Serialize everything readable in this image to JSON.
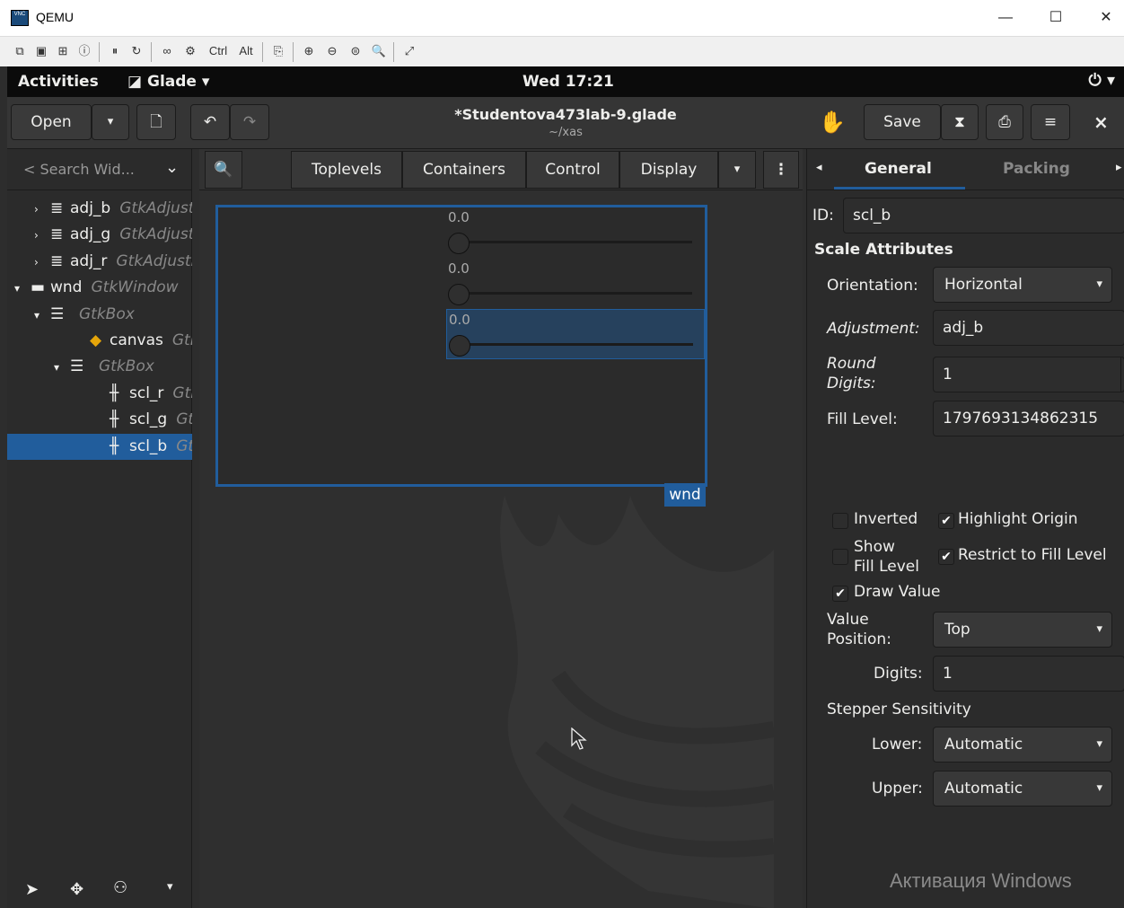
{
  "qemu": {
    "title": "QEMU",
    "logo_text": "VNC",
    "minimize": "—",
    "maximize": "☐",
    "close": "✕",
    "toolbar": [
      "⧉",
      "▣",
      "⊞",
      "ⓘ",
      "⏸",
      "↻",
      "∞",
      "⚙",
      "Ctrl",
      "Alt",
      "⎘",
      "⊕",
      "⊖",
      "⊜",
      "🔍",
      "⤢"
    ]
  },
  "topbar": {
    "activities": "Activities",
    "app_menu": "Glade ▾",
    "app_icon": "glade-icon",
    "clock": "Wed 17:21",
    "power": "⏻ ▾"
  },
  "header": {
    "open_label": "Open",
    "open_arrow": "▾",
    "new_icon": "🗋",
    "undo": "↶",
    "redo": "↷",
    "title": "*Studentova473lab-9.glade",
    "subtitle": "~/xas",
    "save_label": "Save",
    "close": "×"
  },
  "tree": {
    "search_placeholder": "< Search Wid...",
    "search_arrow": "⌄",
    "rows": [
      {
        "expander": "›",
        "icon": "≣",
        "name": "adj_b",
        "type": "GtkAdjustment",
        "indent": 1
      },
      {
        "expander": "›",
        "icon": "≣",
        "name": "adj_g",
        "type": "GtkAdjustment",
        "indent": 1
      },
      {
        "expander": "›",
        "icon": "≣",
        "name": "adj_r",
        "type": "GtkAdjustment",
        "indent": 1
      },
      {
        "expander": "▾",
        "icon": "▬",
        "name": "wnd",
        "type": "GtkWindow",
        "indent": 0
      },
      {
        "expander": "▾",
        "icon": "☰",
        "name": "",
        "type": "GtkBox",
        "indent": 1
      },
      {
        "expander": "",
        "icon": "◆",
        "name": "canvas",
        "type": "GtkDrawingArea",
        "indent": 3
      },
      {
        "expander": "▾",
        "icon": "☰",
        "name": "",
        "type": "GtkBox",
        "indent": 2
      },
      {
        "expander": "",
        "icon": "╫",
        "name": "scl_r",
        "type": "GtkScale",
        "indent": 4
      },
      {
        "expander": "",
        "icon": "╫",
        "name": "scl_g",
        "type": "GtkScale",
        "indent": 4
      },
      {
        "expander": "",
        "icon": "╫",
        "name": "scl_b",
        "type": "GtkScale",
        "indent": 4,
        "selected": true
      }
    ],
    "bottom": [
      "➤",
      "✥",
      "⚇",
      "▾"
    ]
  },
  "palette": {
    "search_icon": "🔍",
    "groups": [
      "Toplevels",
      "Containers",
      "Control",
      "Display"
    ],
    "more": "▾",
    "menu": "⋮"
  },
  "design": {
    "scales": [
      {
        "value": "0.0",
        "level": 0.0
      },
      {
        "value": "0.0",
        "level": 0.0
      },
      {
        "value": "0.0",
        "level": 0.0,
        "selected": true
      }
    ],
    "window_label": "wnd"
  },
  "inspector": {
    "tab_prev": "◂",
    "tab_next": "▸",
    "tabs": [
      "General",
      "Packing"
    ],
    "id_label": "ID:",
    "id_value": "scl_b",
    "section": "Scale Attributes",
    "orientation_label": "Orientation:",
    "orientation_value": "Horizontal",
    "adjustment_label": "Adjustment:",
    "adjustment_value": "adj_b",
    "round_label": "Round\nDigits:",
    "round_value": "1",
    "fill_label": "Fill Level:",
    "fill_value": "1797693134862315",
    "inverted_label": "Inverted",
    "inverted": false,
    "highlight_label": "Highlight Origin",
    "highlight": true,
    "show_fill_label": "Show\nFill Level",
    "show_fill": false,
    "restrict_label": "Restrict to Fill Level",
    "restrict": true,
    "draw_value_label": "Draw Value",
    "draw_value": true,
    "value_pos_label": "Value\nPosition:",
    "value_pos_value": "Top",
    "digits_label": "Digits:",
    "digits_value": "1",
    "stepper_label": "Stepper Sensitivity",
    "lower_label": "Lower:",
    "lower_value": "Automatic",
    "upper_label": "Upper:",
    "upper_value": "Automatic",
    "combo_arrow": "▾",
    "check_mark": "✔",
    "spin_more": "‹"
  },
  "watermark": "Активация Windows"
}
